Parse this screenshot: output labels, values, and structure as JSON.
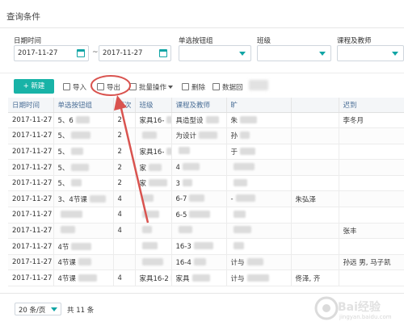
{
  "panel": {
    "title": "查询条件"
  },
  "filters": {
    "date_label": "日期时间",
    "date_from": "2017-11-27",
    "date_sep": "~",
    "date_to": "2017-11-27",
    "radio_label": "单选按钮组",
    "class_label": "班级",
    "course_label": "课程及教师"
  },
  "toolbar": {
    "new_label": "+ 新建",
    "import_label": "导入",
    "export_label": "导出",
    "batch_label": "批量操作",
    "delete_label": "删除",
    "data_label": "数据回"
  },
  "table": {
    "headers": [
      "日期时间",
      "单选按钮组",
      "节次",
      "班级",
      "课程及教师",
      "旷",
      "",
      "迟到"
    ],
    "rows": [
      [
        "2017-11-27",
        "5、6",
        "2",
        "家具16-",
        "具造型设",
        "朱",
        "",
        "李冬月"
      ],
      [
        "2017-11-27",
        "5、",
        "2",
        "",
        "为设计",
        "孙",
        "",
        ""
      ],
      [
        "2017-11-27",
        "5、",
        "2",
        "家具16-",
        "",
        "于",
        "",
        ""
      ],
      [
        "2017-11-27",
        "5、",
        "2",
        "家",
        "4",
        "",
        "",
        ""
      ],
      [
        "2017-11-27",
        "5、",
        "2",
        "家",
        "3",
        "",
        "",
        ""
      ],
      [
        "2017-11-27",
        "3、4节课",
        "4",
        "",
        "6-7",
        "-",
        "朱弘泽",
        ""
      ],
      [
        "2017-11-27",
        "",
        "4",
        "",
        "6-5",
        "",
        "",
        ""
      ],
      [
        "2017-11-27",
        "",
        "4",
        "",
        "",
        "",
        "",
        "张丰"
      ],
      [
        "2017-11-27",
        "4节",
        "",
        "",
        "16-3",
        "",
        "",
        ""
      ],
      [
        "2017-11-27",
        "4节课",
        "",
        "",
        "16-4",
        "计与",
        "",
        "孙远 男, 马子凯"
      ],
      [
        "2017-11-27",
        "4节课",
        "4",
        "家具16-2",
        "家具",
        "计与",
        "佟泽, 齐",
        ""
      ]
    ]
  },
  "pager": {
    "page_size": "20 条/页",
    "total": "共 11 条"
  },
  "watermark": {
    "brand": "Bai经验",
    "sub": "jingyan.baidu.com"
  },
  "colors": {
    "accent": "#18b3a7",
    "annotation": "#d9534f",
    "header_text": "#4b6f97"
  }
}
